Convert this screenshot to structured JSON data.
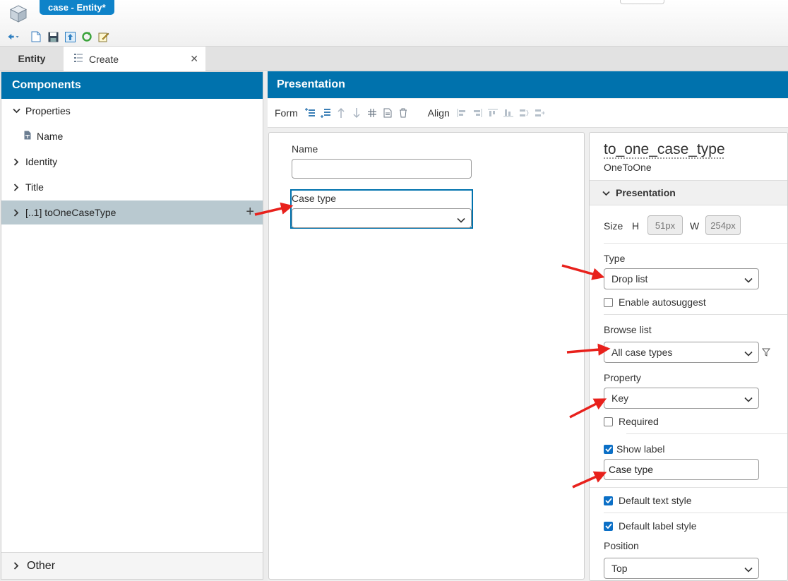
{
  "window": {
    "doc_tab": "case - Entity*"
  },
  "tabs": {
    "entity": "Entity",
    "create": "Create"
  },
  "components": {
    "title": "Components",
    "items": [
      {
        "label": "Properties"
      },
      {
        "label": "Name"
      },
      {
        "label": "Identity"
      },
      {
        "label": "Title"
      },
      {
        "label": "[..1] toOneCaseType"
      }
    ],
    "other": "Other"
  },
  "presentation": {
    "title": "Presentation",
    "toolbar": {
      "form": "Form",
      "align": "Align"
    },
    "form": {
      "name_label": "Name",
      "name_value": "",
      "case_type_label": "Case type",
      "case_type_value": ""
    }
  },
  "properties": {
    "name": "to_one_case_type",
    "kind": "OneToOne",
    "section": "Presentation",
    "size_label": "Size",
    "h_label": "H",
    "h_value": "51px",
    "w_label": "W",
    "w_value": "254px",
    "type_label": "Type",
    "type_value": "Drop list",
    "autosuggest_label": "Enable autosuggest",
    "autosuggest_checked": false,
    "browse_list_label": "Browse list",
    "browse_list_value": "All case types",
    "property_label": "Property",
    "property_value": "Key",
    "required_label": "Required",
    "required_checked": false,
    "show_label_label": "Show label",
    "show_label_checked": true,
    "label_text": "Case type",
    "default_text_style_label": "Default text style",
    "default_text_style_checked": true,
    "default_label_style_label": "Default label style",
    "default_label_style_checked": true,
    "position_label": "Position",
    "position_value": "Top"
  },
  "colors": {
    "header_blue": "#0072ad",
    "doc_tab_blue": "#0f83c9",
    "selected_row": "#b9c9d0",
    "annotation_red": "#e8211c"
  }
}
